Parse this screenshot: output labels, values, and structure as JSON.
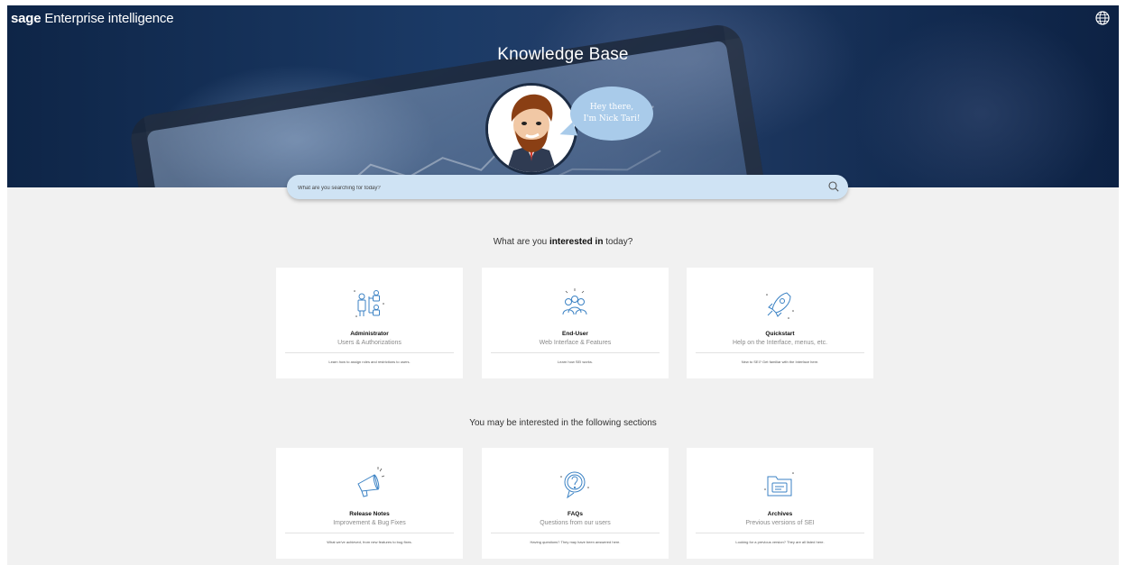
{
  "brand": {
    "bold": "sage",
    "rest": "Enterprise intelligence"
  },
  "hero": {
    "title": "Knowledge Base",
    "bubble_line1": "Hey there,",
    "bubble_line2": "I'm Nick Tari!"
  },
  "search": {
    "placeholder": "What are you searching for today?"
  },
  "interest_heading": {
    "pre": "What are you ",
    "bold": "interested in",
    "post": " today?"
  },
  "sections_heading": "You may be interested in the following sections",
  "cards_top": [
    {
      "title": "Administrator",
      "subtitle": "Users & Authorizations",
      "desc": "Learn how to assign roles and restrictions to users.",
      "icon": "administrator-icon"
    },
    {
      "title": "End-User",
      "subtitle": "Web Interface & Features",
      "desc": "Learn how SEI works.",
      "icon": "end-user-icon"
    },
    {
      "title": "Quickstart",
      "subtitle": "Help on the Interface, menus, etc.",
      "desc": "New to SEI? Get familiar with the Interface here.",
      "icon": "rocket-icon"
    }
  ],
  "cards_bottom": [
    {
      "title": "Release Notes",
      "subtitle": "Improvement & Bug Fixes",
      "desc": "What we've achieved, from new features to bug fixes.",
      "icon": "megaphone-icon"
    },
    {
      "title": "FAQs",
      "subtitle": "Questions from our users",
      "desc": "Having questions? They may have been answered here.",
      "icon": "question-icon"
    },
    {
      "title": "Archives",
      "subtitle": "Previous versions of SEI",
      "desc": "Looking for a previous version? They are all listed here.",
      "icon": "archive-folder-icon"
    }
  ],
  "colors": {
    "hero_dark": "#0e2547",
    "accent": "#3b82c4",
    "search_bg": "#cfe3f4",
    "bubble": "#a9cbea"
  }
}
